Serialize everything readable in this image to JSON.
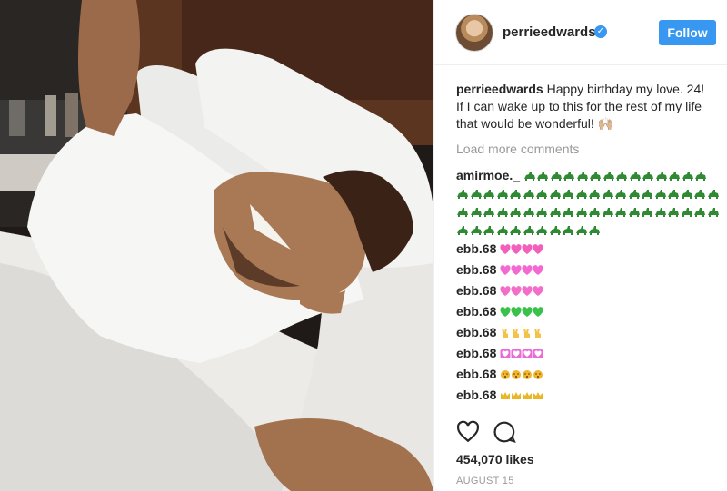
{
  "post": {
    "username": "perrieedwards",
    "verified_mark": "✓",
    "follow_label": "Follow",
    "caption_user": "perrieedwards",
    "caption_text": " Happy birthday my love. 24! If I can wake up to this for the rest of my life that would be wonderful! 🙌🏼",
    "load_more": "Load more comments",
    "likes": "454,070 likes",
    "date": "AUGUST 15"
  },
  "comments": [
    {
      "user": "amirmoe._",
      "emoji": "crocodile",
      "count": 65
    },
    {
      "user": "ebb.68",
      "emoji": "heart-stack",
      "color": "#f25fbd",
      "count": 4
    },
    {
      "user": "ebb.68",
      "emoji": "heart-sparkle",
      "color": "#f26ad1",
      "count": 4
    },
    {
      "user": "ebb.68",
      "emoji": "heart-pink",
      "color": "#f26ec8",
      "count": 4
    },
    {
      "user": "ebb.68",
      "emoji": "heart-green",
      "color": "#39c24a",
      "count": 4
    },
    {
      "user": "ebb.68",
      "emoji": "victory-hand",
      "color": "#f3c349",
      "count": 4
    },
    {
      "user": "ebb.68",
      "emoji": "heart-decoration",
      "color": "#e86bd6",
      "count": 4
    },
    {
      "user": "ebb.68",
      "emoji": "kissing-face",
      "color": "#f0b52e",
      "count": 4
    },
    {
      "user": "ebb.68",
      "emoji": "crown",
      "color": "#e9b628",
      "count": 4
    }
  ],
  "icons": {
    "like": "heart-outline-icon",
    "comment": "comment-bubble-icon",
    "verified": "verified-badge-icon"
  },
  "colors": {
    "accent": "#3897f0",
    "muted": "#999999",
    "text": "#262626",
    "crocodile": "#2f8a33"
  }
}
